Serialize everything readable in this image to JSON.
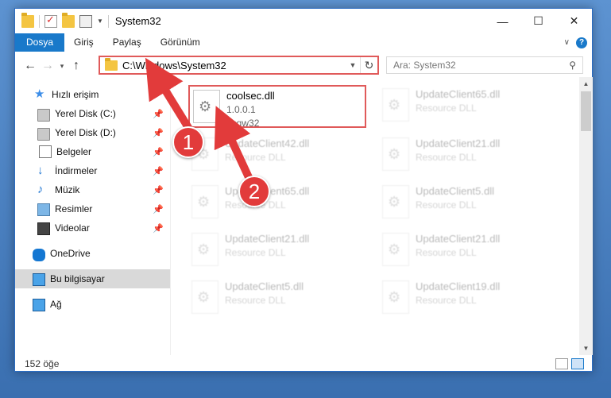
{
  "window": {
    "title": "System32"
  },
  "ribbon": {
    "tabs": [
      "Dosya",
      "Giriş",
      "Paylaş",
      "Görünüm"
    ],
    "help_label": "?"
  },
  "nav": {
    "address": "C:\\Windows\\System32",
    "search_placeholder": "Ara: System32"
  },
  "sidebar": {
    "items": [
      {
        "label": "Hızlı erişim",
        "icon": "star-icon",
        "pinned": false
      },
      {
        "label": "Yerel Disk (C:)",
        "icon": "drive-icon",
        "pinned": true
      },
      {
        "label": "Yerel Disk (D:)",
        "icon": "drive-icon",
        "pinned": true
      },
      {
        "label": "Belgeler",
        "icon": "documents-icon",
        "pinned": true
      },
      {
        "label": "İndirmeler",
        "icon": "downloads-icon",
        "pinned": true
      },
      {
        "label": "Müzik",
        "icon": "music-icon",
        "pinned": true
      },
      {
        "label": "Resimler",
        "icon": "pictures-icon",
        "pinned": true
      },
      {
        "label": "Videolar",
        "icon": "videos-icon",
        "pinned": true
      },
      {
        "label": "OneDrive",
        "icon": "onedrive-icon",
        "pinned": false
      },
      {
        "label": "Bu bilgisayar",
        "icon": "computer-icon",
        "pinned": false,
        "selected": true
      },
      {
        "label": "Ağ",
        "icon": "network-icon",
        "pinned": false
      }
    ]
  },
  "files": [
    {
      "name": "coolsec.dll",
      "line2": "1.0.0.1",
      "line3": "pcgw32",
      "highlighted": true
    },
    {
      "name": "UpdateClient65.dll",
      "line2": "Resource DLL"
    },
    {
      "name": "UpdateClient42.dll",
      "line2": "Resource DLL"
    },
    {
      "name": "UpdateClient21.dll",
      "line2": "Resource DLL"
    },
    {
      "name": "UpdateClient65.dll",
      "line2": "Resource DLL"
    },
    {
      "name": "UpdateClient5.dll",
      "line2": "Resource DLL"
    },
    {
      "name": "UpdateClient21.dll",
      "line2": "Resource DLL"
    },
    {
      "name": "UpdateClient21.dll",
      "line2": "Resource DLL"
    },
    {
      "name": "UpdateClient5.dll",
      "line2": "Resource DLL"
    },
    {
      "name": "UpdateClient19.dll",
      "line2": "Resource DLL"
    }
  ],
  "status": {
    "item_count": "152 öğe"
  },
  "annotations": {
    "badge1": "1",
    "badge2": "2"
  },
  "colors": {
    "accent": "#1979ca",
    "highlight": "#e05a5a",
    "badge": "#e23b3b"
  }
}
